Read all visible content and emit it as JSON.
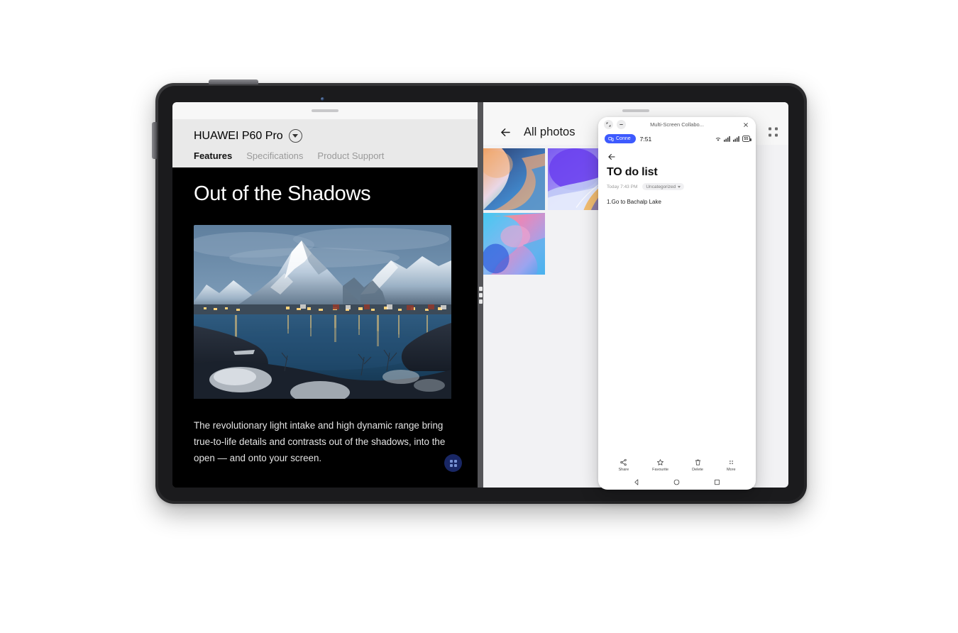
{
  "device": {
    "type": "tablet",
    "camera_icon": "front-camera-dot",
    "power_button": "power-button",
    "volume_button": "volume-button"
  },
  "left_pane": {
    "product_name": "HUAWEI P60 Pro",
    "dropdown_icon": "chevron-down-icon",
    "tabs": [
      {
        "label": "Features",
        "active": true
      },
      {
        "label": "Specifications",
        "active": false
      },
      {
        "label": "Product Support",
        "active": false
      }
    ],
    "hero_heading": "Out of the Shadows",
    "hero_photo_alt": "Snow-covered mountains and fishing village reflected in a calm fjord at dusk",
    "paragraph": "The revolutionary light intake and high dynamic range bring true-to-life details and contrasts out of the shadows, into the open — and onto your screen.",
    "fab_icon": "app-grid-icon",
    "fab_color": "#1b2a6b"
  },
  "split_divider": {
    "handle_icon": "drag-handle-icon"
  },
  "gallery": {
    "back_icon": "arrow-left-icon",
    "title": "All photos",
    "menu_icon": "four-dot-menu-icon",
    "thumbnails": [
      {
        "name": "wallpaper-orange-blue-swirl"
      },
      {
        "name": "wallpaper-purple-violet-wave"
      },
      {
        "name": "wallpaper-pink-magenta-gradient"
      },
      {
        "name": "wallpaper-cyan-pink-ribbon"
      }
    ]
  },
  "phone_window": {
    "title": "Multi-Screen Collabo...",
    "resize_icon": "resize-icon",
    "minimize_icon": "minimize-icon",
    "close_icon": "close-icon",
    "statusbar": {
      "connect_label": "Conne",
      "connect_icon": "connected-device-icon",
      "connect_color": "#3d5afe",
      "time": "7:51",
      "wifi_icon": "wifi-icon",
      "signal_icon_1": "signal-bars-icon",
      "signal_icon_2": "signal-bars-sim2-icon",
      "battery_level": "55",
      "battery_icon": "battery-icon"
    },
    "note": {
      "back_icon": "arrow-left-icon",
      "title": "TO do list",
      "date": "Today 7:43 PM",
      "tag": "Uncategorized",
      "tag_caret_icon": "chevron-down-icon",
      "body": "1.Go to  Bachalp Lake"
    },
    "toolbar": [
      {
        "label": "Share",
        "icon": "share-icon"
      },
      {
        "label": "Favourite",
        "icon": "star-icon"
      },
      {
        "label": "Delete",
        "icon": "trash-icon"
      },
      {
        "label": "More",
        "icon": "more-dots-icon"
      }
    ],
    "navbar": [
      {
        "name": "back",
        "icon": "nav-back-triangle-icon"
      },
      {
        "name": "home",
        "icon": "nav-home-circle-icon"
      },
      {
        "name": "recents",
        "icon": "nav-recents-square-icon"
      }
    ]
  }
}
